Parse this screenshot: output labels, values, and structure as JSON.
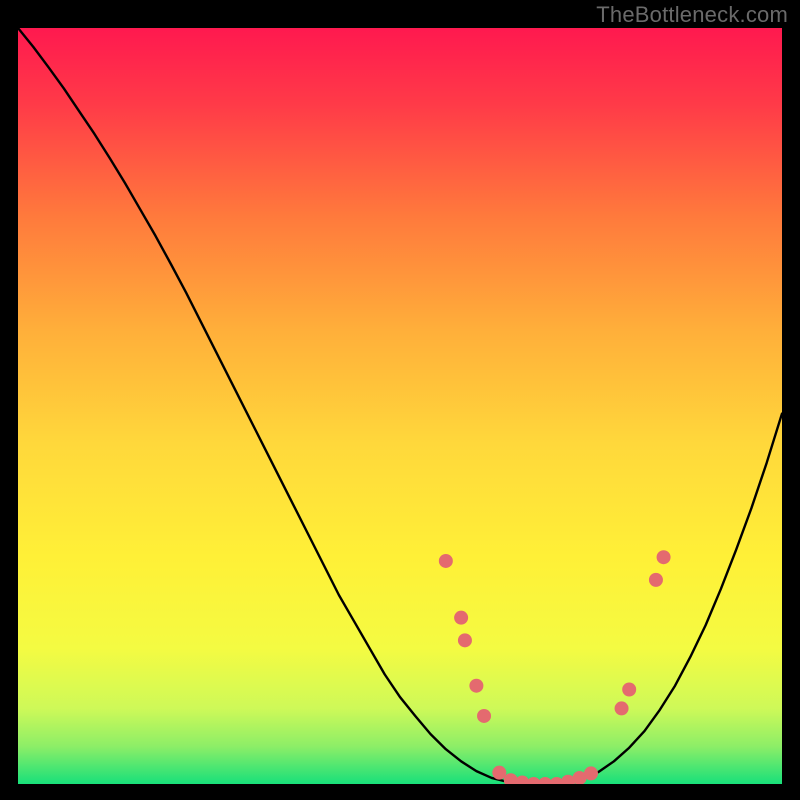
{
  "watermark": "TheBottleneck.com",
  "chart_data": {
    "type": "line",
    "title": "",
    "xlabel": "",
    "ylabel": "",
    "xlim": [
      0,
      100
    ],
    "ylim": [
      0,
      100
    ],
    "grid": false,
    "legend": "none",
    "background_gradient": {
      "top_color": "#ff194f",
      "mid_color": "#fff037",
      "bottom_color": "#18e07a"
    },
    "series": [
      {
        "name": "curve",
        "color": "#000000",
        "x": [
          0,
          2,
          4,
          6,
          8,
          10,
          12,
          14,
          16,
          18,
          20,
          22,
          24,
          26,
          28,
          30,
          32,
          34,
          36,
          38,
          40,
          42,
          44,
          46,
          48,
          50,
          52,
          54,
          56,
          58,
          60,
          62,
          64,
          66,
          68,
          70,
          72,
          74,
          76,
          78,
          80,
          82,
          84,
          86,
          88,
          90,
          92,
          94,
          96,
          98,
          100
        ],
        "y": [
          100,
          97.5,
          94.8,
          92,
          89,
          86,
          82.8,
          79.5,
          76,
          72.5,
          68.8,
          65,
          61,
          57,
          53,
          49,
          45,
          41,
          37,
          33,
          29,
          25,
          21.5,
          18,
          14.5,
          11.5,
          9,
          6.6,
          4.6,
          3,
          1.7,
          0.8,
          0.3,
          0,
          0,
          0,
          0.2,
          0.7,
          1.6,
          3,
          4.8,
          7,
          9.8,
          13,
          16.8,
          21,
          25.8,
          31,
          36.5,
          42.5,
          49
        ]
      }
    ],
    "markers": {
      "color": "#e46a6f",
      "radius": 7,
      "points": [
        {
          "x": 56,
          "y": 29.5
        },
        {
          "x": 58,
          "y": 22
        },
        {
          "x": 58.5,
          "y": 19
        },
        {
          "x": 60,
          "y": 13
        },
        {
          "x": 61,
          "y": 9
        },
        {
          "x": 63,
          "y": 1.5
        },
        {
          "x": 64.5,
          "y": 0.5
        },
        {
          "x": 66,
          "y": 0.2
        },
        {
          "x": 67.5,
          "y": 0
        },
        {
          "x": 69,
          "y": 0
        },
        {
          "x": 70.5,
          "y": 0
        },
        {
          "x": 72,
          "y": 0.3
        },
        {
          "x": 73.5,
          "y": 0.8
        },
        {
          "x": 75,
          "y": 1.4
        },
        {
          "x": 79,
          "y": 10
        },
        {
          "x": 80,
          "y": 12.5
        },
        {
          "x": 83.5,
          "y": 27
        },
        {
          "x": 84.5,
          "y": 30
        }
      ]
    }
  }
}
